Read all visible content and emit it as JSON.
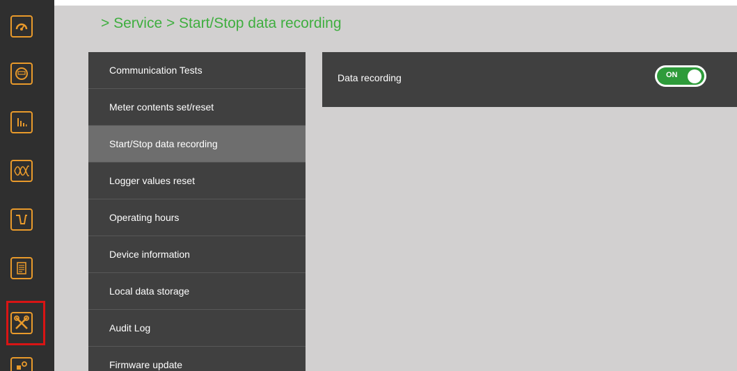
{
  "breadcrumb": "> Service > Start/Stop data recording",
  "nav": {
    "icons": [
      "gauge-icon",
      "meter-icon",
      "bar-chart-icon",
      "waveform-icon",
      "signal-icon",
      "document-list-icon",
      "tools-icon",
      "settings-icon"
    ],
    "selected": "tools-icon"
  },
  "menu": {
    "items": [
      {
        "label": "Communication Tests"
      },
      {
        "label": "Meter contents set/reset"
      },
      {
        "label": "Start/Stop data recording"
      },
      {
        "label": "Logger values reset"
      },
      {
        "label": "Operating hours"
      },
      {
        "label": "Device information"
      },
      {
        "label": "Local data storage"
      },
      {
        "label": "Audit Log"
      },
      {
        "label": "Firmware update"
      }
    ],
    "active_index": 2
  },
  "setting": {
    "label": "Data recording",
    "toggle_text": "ON",
    "toggle_on": true
  },
  "colors": {
    "accent": "#3fae3f",
    "icon_orange": "#e99a2b",
    "selection_red": "#d91414",
    "toggle_green": "#2e9b3a"
  }
}
